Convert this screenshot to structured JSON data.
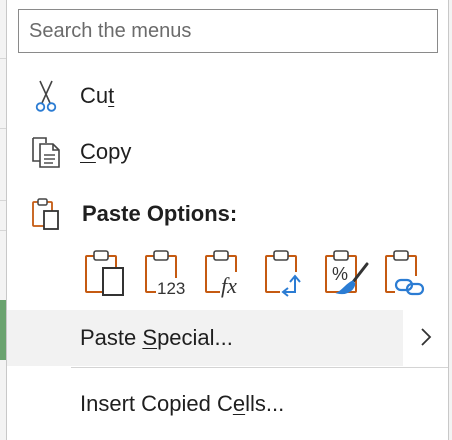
{
  "search": {
    "placeholder": "Search the menus",
    "value": ""
  },
  "menu": {
    "cut": {
      "pre": "Cu",
      "key": "t",
      "post": "",
      "icon": "scissors-icon"
    },
    "copy": {
      "pre": "",
      "key": "C",
      "post": "opy",
      "icon": "copy-icon"
    },
    "paste_options": {
      "label": "Paste Options:",
      "icon": "clipboard-icon"
    },
    "paste_buttons": [
      {
        "name": "paste-icon",
        "caption": ""
      },
      {
        "name": "paste-values-icon",
        "caption": "123"
      },
      {
        "name": "paste-formulas-icon",
        "caption": "fx"
      },
      {
        "name": "paste-transpose-icon",
        "caption": ""
      },
      {
        "name": "paste-formatting-icon",
        "caption": "%"
      },
      {
        "name": "paste-link-icon",
        "caption": ""
      }
    ],
    "paste_special": {
      "pre": "Paste ",
      "key": "S",
      "post": "pecial...",
      "icon": "chevron-right-icon"
    },
    "insert_copied": {
      "pre": "Insert Copied C",
      "key": "e",
      "post": "lls..."
    }
  },
  "colors": {
    "clipboard_orange": "#c55a11",
    "accent_blue": "#2b7cd3",
    "hover_bg": "#f2f2f2"
  }
}
